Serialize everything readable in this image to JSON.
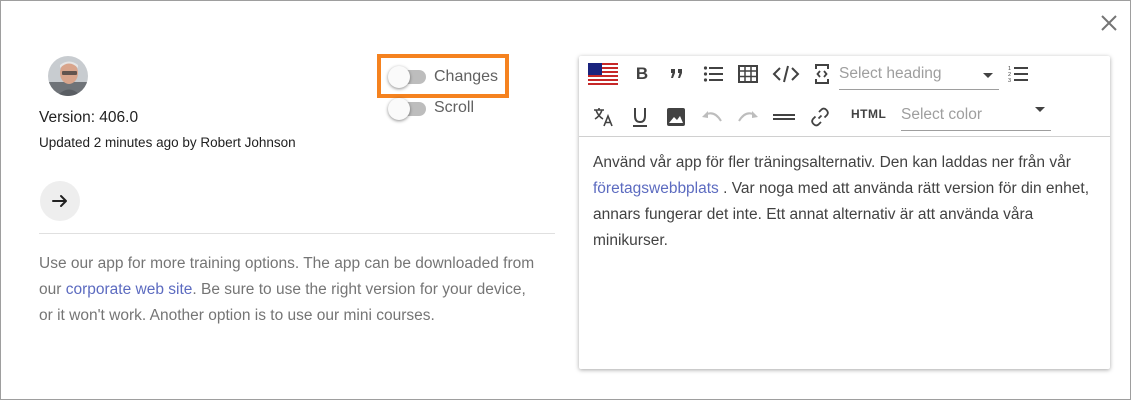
{
  "close": {
    "icon": "close-icon"
  },
  "item": {
    "version": "Version: 406.0",
    "updated": "Updated 2 minutes ago by Robert Johnson",
    "description_pre": "Use our app for more training options. The app can be downloaded from our ",
    "description_link": "corporate web site",
    "description_post": ". Be sure to use the right version for your device, or it won't work. Another option is to use our mini courses."
  },
  "toggles": {
    "changes": {
      "label": "Changes",
      "on": false
    },
    "scroll": {
      "label": "Scroll",
      "on": false
    }
  },
  "toolbar": {
    "heading_placeholder": "Select heading",
    "color_placeholder": "Select color",
    "html_label": "HTML",
    "bold_label": "B",
    "icons": [
      "us-flag-icon",
      "bold-icon",
      "quote-icon",
      "bullet-list-icon",
      "table-icon",
      "code-icon",
      "source-icon",
      "numbered-list-icon",
      "translate-icon",
      "underline-icon",
      "image-icon",
      "undo-icon",
      "redo-icon",
      "horizontal-rule-icon",
      "link-icon"
    ]
  },
  "editor": {
    "text_pre": "Använd vår app för fler träningsalternativ. Den kan laddas ner från vår ",
    "text_link": "företagswebbplats",
    "text_post": " . Var noga med att använda rätt version för din enhet, annars fungerar det inte. Ett annat alternativ är att använda våra minikurser."
  },
  "colors": {
    "highlight": "#f5821f",
    "link": "#5c6bc0",
    "toggle_off": "#bdbdbd"
  }
}
